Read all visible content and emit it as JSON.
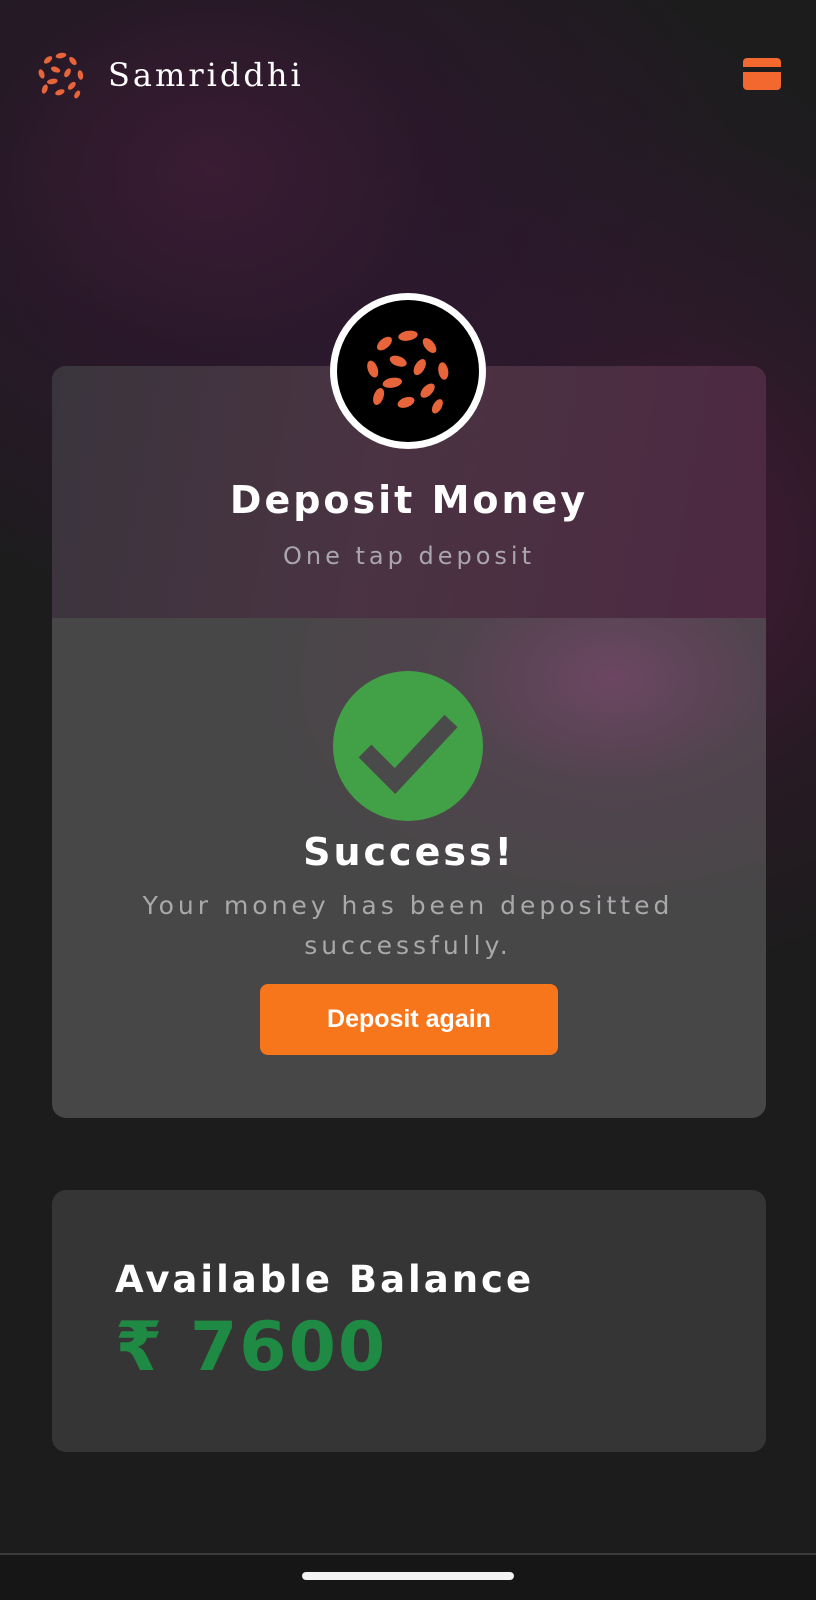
{
  "app": {
    "name": "Samriddhi",
    "logo_icon": "grain-logo-icon",
    "accent_color": "#f8761b"
  },
  "header": {
    "card_icon": "credit-card-icon"
  },
  "deposit_card": {
    "title": "Deposit Money",
    "subtitle": "One tap deposit",
    "status_icon": "check-circle-icon",
    "status_color": "#42a147",
    "success_title": "Success!",
    "success_message": "Your money has been depositted successfully.",
    "button_label": "Deposit again"
  },
  "balance": {
    "label": "Available Balance",
    "amount": "₹ 7600",
    "amount_color": "#1f8a43"
  }
}
